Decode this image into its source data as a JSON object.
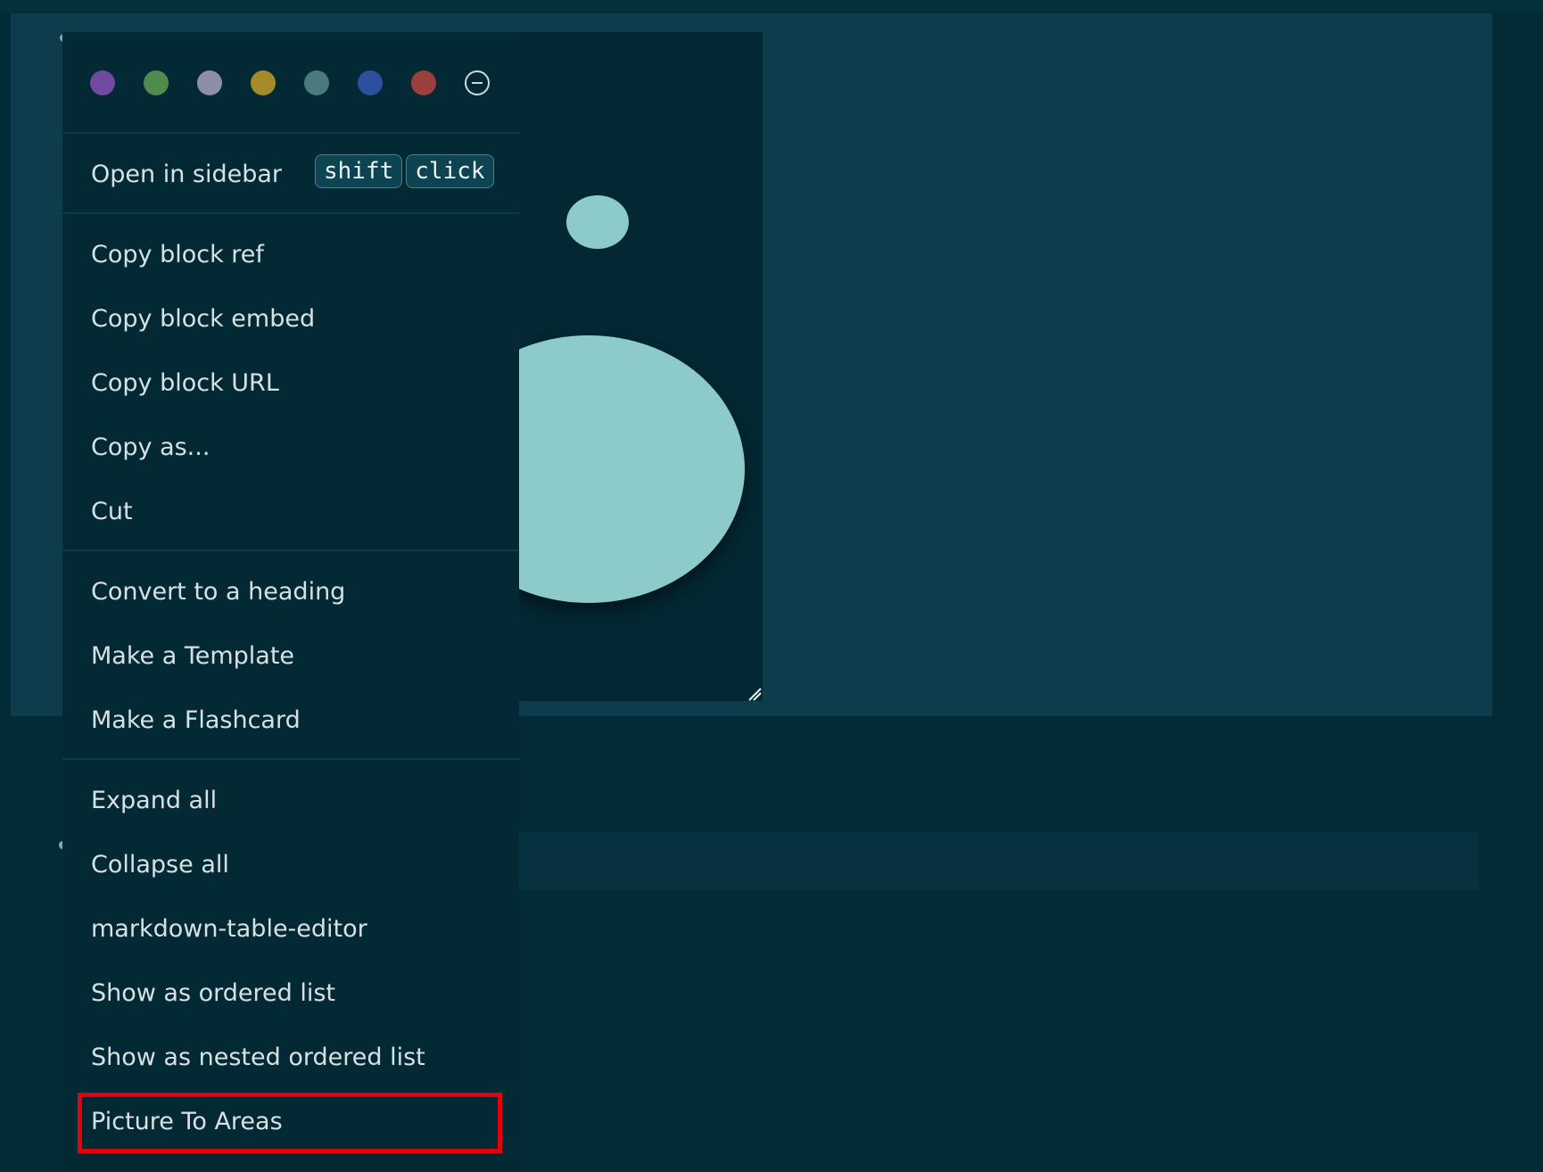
{
  "colors": {
    "page_background": "#022b35",
    "block_highlight": "#0d3c4c",
    "menu_background": "#032a34",
    "image_shape": "#8ccbca",
    "annotation_box": "#e3000f"
  },
  "color_swatches": [
    {
      "name": "purple",
      "hex": "#6f4aa0"
    },
    {
      "name": "green",
      "hex": "#4f8a4f"
    },
    {
      "name": "gray",
      "hex": "#8f8ea7"
    },
    {
      "name": "yellow",
      "hex": "#a58c2a"
    },
    {
      "name": "teal",
      "hex": "#4b7a7e"
    },
    {
      "name": "blue",
      "hex": "#2c4fa0"
    },
    {
      "name": "red",
      "hex": "#9b3f3d"
    }
  ],
  "icons": {
    "clear_color": "remove-circle-icon",
    "resize_handle": "resize-handle-icon"
  },
  "menu": {
    "open_in_sidebar": "Open in sidebar",
    "shortcut_keys": [
      "shift",
      "click"
    ],
    "items_group_1": [
      "Copy block ref",
      "Copy block embed",
      "Copy block URL",
      "Copy as...",
      "Cut"
    ],
    "items_group_2": [
      "Convert to a heading",
      "Make a Template",
      "Make a Flashcard"
    ],
    "items_group_3": [
      "Expand all",
      "Collapse all",
      "markdown-table-editor",
      "Show as ordered list",
      "Show as nested ordered list",
      "Picture To Areas"
    ]
  }
}
